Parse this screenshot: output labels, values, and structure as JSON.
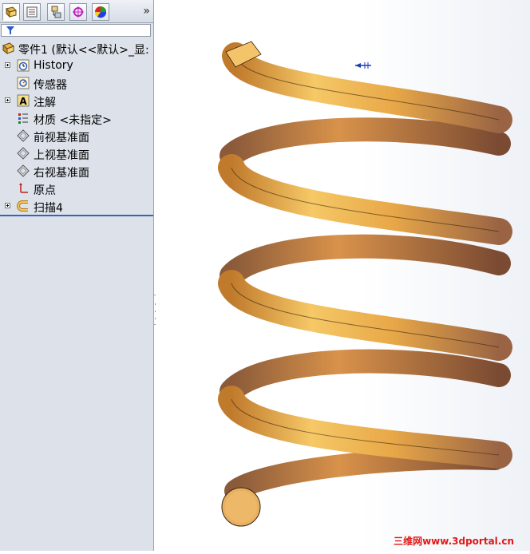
{
  "panel": {
    "tabs": [
      {
        "icon": "feature-manager-icon"
      },
      {
        "icon": "property-manager-icon"
      },
      {
        "icon": "configuration-manager-icon"
      },
      {
        "icon": "dimxpert-icon"
      },
      {
        "icon": "display-manager-icon"
      }
    ],
    "more_label": "»",
    "root": "零件1 (默认<<默认>_显:",
    "items": [
      {
        "label": "History",
        "icon": "history-icon",
        "expandable": true
      },
      {
        "label": "传感器",
        "icon": "sensor-icon",
        "expandable": false
      },
      {
        "label": "注解",
        "icon": "annotation-icon",
        "expandable": true
      },
      {
        "label": "材质 <未指定>",
        "icon": "material-icon",
        "expandable": false
      },
      {
        "label": "前视基准面",
        "icon": "plane-icon",
        "expandable": false
      },
      {
        "label": "上视基准面",
        "icon": "plane-icon",
        "expandable": false
      },
      {
        "label": "右视基准面",
        "icon": "plane-icon",
        "expandable": false
      },
      {
        "label": "原点",
        "icon": "origin-icon",
        "expandable": false
      },
      {
        "label": "扫描4",
        "icon": "sweep-icon",
        "expandable": true
      }
    ]
  },
  "viewport": {
    "model": "spring-helix",
    "colors": {
      "spring_light": "#f4c46a",
      "spring_mid": "#e09a3c",
      "spring_dark": "#8a5a3a",
      "edge": "#3b2410"
    }
  },
  "watermark": "三维网www.3dportal.cn"
}
